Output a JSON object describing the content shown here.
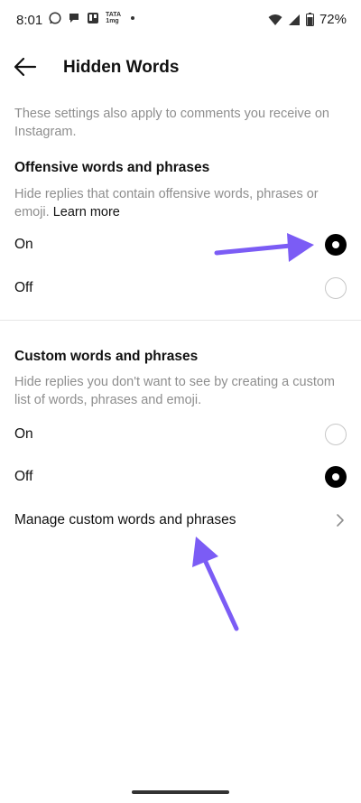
{
  "status_bar": {
    "time": "8:01",
    "tata_label": "TATA\n1mg",
    "battery": "72%"
  },
  "header": {
    "title": "Hidden Words"
  },
  "intro": "These settings also apply to comments you receive on Instagram.",
  "offensive": {
    "title": "Offensive words and phrases",
    "description": "Hide replies that contain offensive words, phrases or emoji.",
    "learn_more": "Learn more",
    "options": [
      {
        "label": "On",
        "selected": true
      },
      {
        "label": "Off",
        "selected": false
      }
    ]
  },
  "custom": {
    "title": "Custom words and phrases",
    "description": "Hide replies you don't want to see by creating a custom list of words, phrases and emoji.",
    "options": [
      {
        "label": "On",
        "selected": false
      },
      {
        "label": "Off",
        "selected": true
      }
    ],
    "manage_label": "Manage custom words and phrases"
  },
  "colors": {
    "annotation_arrow": "#7b5cf5",
    "muted_text": "#8e8e8e"
  }
}
